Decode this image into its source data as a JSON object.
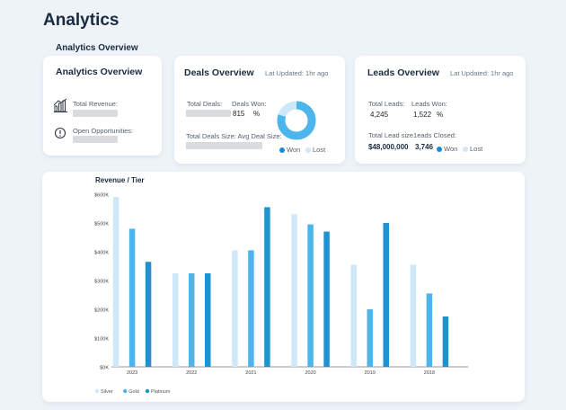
{
  "header": {
    "title": "Analytics",
    "section": "Analytics Overview"
  },
  "analytics_card": {
    "title": "Analytics Overview",
    "total_revenue_label": "Total Revenue:",
    "open_opps_label": "Open Opportunities:",
    "icons": [
      "bar-chart-icon",
      "clock-alert-icon"
    ]
  },
  "deals_card": {
    "title": "Deals Overview",
    "updated": "Lat Updated: 1hr ago",
    "total_deals_label": "Total Deals:",
    "deals_won_label": "Deals Won:",
    "deals_won_value": "815",
    "deals_won_unit": "%",
    "size_label": "Total Deals Size: Avg Deal Size:",
    "legend_won": "Won",
    "legend_lost": "Lost",
    "won_fraction": 0.8,
    "colors": {
      "won": "#4bb5ec",
      "lost": "#cfe8f7"
    }
  },
  "leads_card": {
    "title": "Leads Overview",
    "updated": "Lat Updated: 1hr ago",
    "total_leads_label": "Total Leads:",
    "total_leads_value": "4,245",
    "leads_won_label": "Leads Won:",
    "leads_won_value": "1,522",
    "leads_won_unit": "%",
    "size_label": "Total Lead size1eads Closed:",
    "size_value": "$48,000,000",
    "closed_value": "3,746",
    "legend_won": "Won",
    "legend_lost": "Lost"
  },
  "chart_data": {
    "type": "bar",
    "title": "Revenue / Tier",
    "categories": [
      "2023",
      "2022",
      "2021",
      "2020",
      "2019",
      "2018"
    ],
    "series": [
      {
        "name": "Silver",
        "color": "#cfe8f7",
        "values": [
          590,
          325,
          405,
          530,
          355,
          355
        ]
      },
      {
        "name": "Gold",
        "color": "#4bb5ec",
        "values": [
          480,
          325,
          405,
          495,
          200,
          255
        ]
      },
      {
        "name": "Platinum",
        "color": "#1e93d0",
        "values": [
          365,
          325,
          555,
          470,
          500,
          175
        ]
      }
    ],
    "yticks": [
      "$0K",
      "$100K",
      "$200K",
      "$300K",
      "$400K",
      "$500K",
      "$600K"
    ],
    "ylim": [
      0,
      600
    ],
    "legend_position": "bottom-left"
  }
}
